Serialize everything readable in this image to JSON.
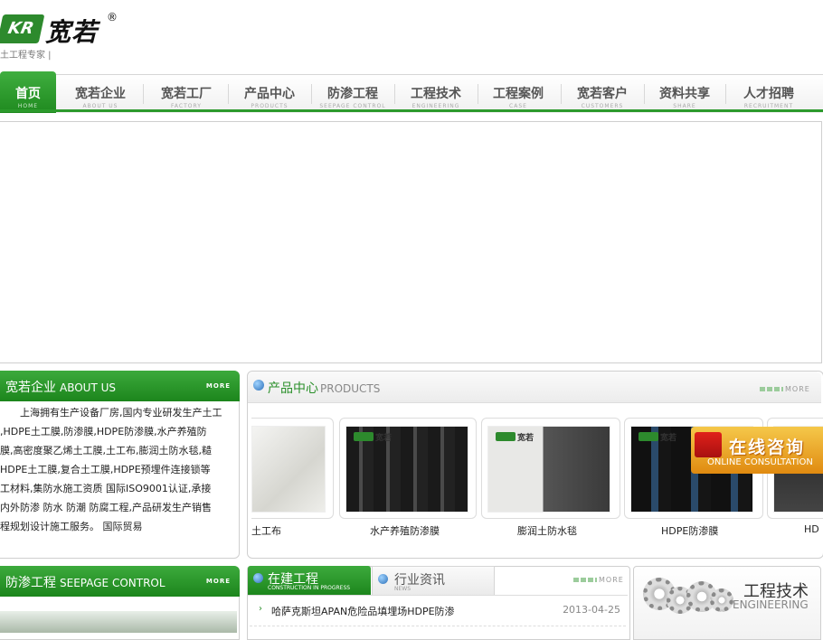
{
  "header": {
    "logo_mark": "KR",
    "logo_name": "宽若",
    "logo_reg": "®",
    "logo_tagline": "土工程专家 |"
  },
  "nav": {
    "items": [
      {
        "cn": "首页",
        "en": "HOME",
        "active": true
      },
      {
        "cn": "宽若企业",
        "en": "ABOUT US"
      },
      {
        "cn": "宽若工厂",
        "en": "FACTORY"
      },
      {
        "cn": "产品中心",
        "en": "PRODUCTS"
      },
      {
        "cn": "防渗工程",
        "en": "SEEPAGE CONTROL"
      },
      {
        "cn": "工程技术",
        "en": "ENGINEERING"
      },
      {
        "cn": "工程案例",
        "en": "CASE"
      },
      {
        "cn": "宽若客户",
        "en": "CUSTOMERS"
      },
      {
        "cn": "资料共享",
        "en": "SHARE"
      },
      {
        "cn": "人才招聘",
        "en": "RECRUITMENT"
      }
    ]
  },
  "about": {
    "title_cn": "宽若企业",
    "title_en": "ABOUT US",
    "more": "MORE",
    "lines": [
      "　　上海拥有生产设备厂房,国内专业研发生产土工",
      ",HDPE土工膜,防渗膜,HDPE防渗膜,水产养殖防",
      "膜,高密度聚乙烯土工膜,土工布,膨润土防水毯,糙",
      "HDPE土工膜,复合土工膜,HDPE预埋件连接锁等",
      "工材料,集防水施工资质 国际ISO9001认证,承接",
      "内外防渗 防水 防潮 防腐工程,产品研发生产销售",
      "程规划设计施工服务。 国际贸易"
    ]
  },
  "seepage": {
    "title_cn": "防渗工程",
    "title_en": "SEEPAGE CONTROL",
    "more": "MORE"
  },
  "products": {
    "title_cn": "产品中心",
    "title_en": "PRODUCTS",
    "more": "MORE",
    "items": [
      {
        "caption": "土工布"
      },
      {
        "caption": "水产养殖防渗膜"
      },
      {
        "caption": "膨润土防水毯"
      },
      {
        "caption": "HDPE防渗膜"
      },
      {
        "caption": "HD"
      }
    ],
    "brand": "宽若"
  },
  "consult": {
    "cn": "在线咨询",
    "en": "ONLINE CONSULTATION"
  },
  "news": {
    "tab1_cn": "在建工程",
    "tab1_en": "CONSTRUCTION IN PROGRESS",
    "tab2_cn": "行业资讯",
    "tab2_en": "NEWS",
    "more": "MORE",
    "rows": [
      {
        "title": "哈萨克斯坦APAN危险品填埋场HDPE防渗",
        "date": "2013-04-25"
      }
    ]
  },
  "engineering": {
    "cn": "工程技术",
    "en": "ENGINEERING"
  },
  "colors": {
    "brand_green": "#2c9a2c",
    "consult_orange": "#e08a10"
  }
}
